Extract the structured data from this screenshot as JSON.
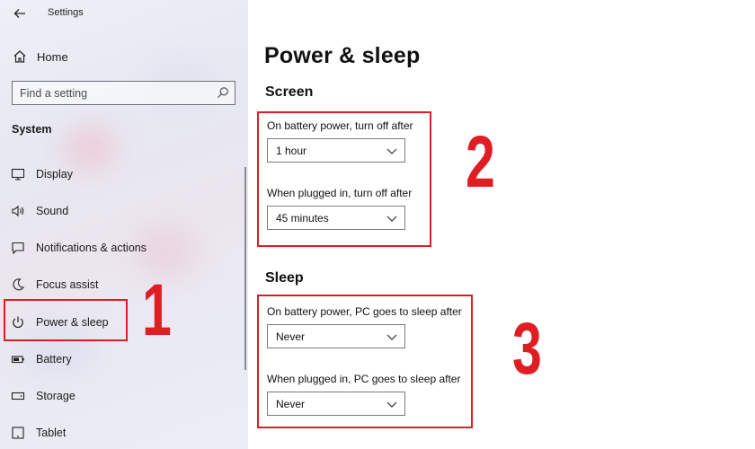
{
  "window": {
    "title": "Settings"
  },
  "sidebar": {
    "home_label": "Home",
    "search_placeholder": "Find a setting",
    "section_label": "System",
    "items": [
      {
        "label": "Display",
        "icon": "display-icon"
      },
      {
        "label": "Sound",
        "icon": "speaker-icon"
      },
      {
        "label": "Notifications & actions",
        "icon": "notifications-icon"
      },
      {
        "label": "Focus assist",
        "icon": "moon-icon"
      },
      {
        "label": "Power & sleep",
        "icon": "power-icon",
        "selected": true
      },
      {
        "label": "Battery",
        "icon": "battery-icon"
      },
      {
        "label": "Storage",
        "icon": "storage-icon"
      },
      {
        "label": "Tablet",
        "icon": "tablet-icon"
      }
    ]
  },
  "main": {
    "page_title": "Power & sleep",
    "screen": {
      "heading": "Screen",
      "battery_label": "On battery power, turn off after",
      "battery_value": "1 hour",
      "plugged_label": "When plugged in, turn off after",
      "plugged_value": "45 minutes"
    },
    "sleep": {
      "heading": "Sleep",
      "battery_label": "On battery power, PC goes to sleep after",
      "battery_value": "Never",
      "plugged_label": "When plugged in, PC goes to sleep after",
      "plugged_value": "Never"
    }
  },
  "annotations": {
    "step1": "1",
    "step2": "2",
    "step3": "3"
  },
  "colors": {
    "highlight": "#e11d24",
    "sidebar_bg": "#eceef6",
    "content_bg": "#ffffff"
  }
}
